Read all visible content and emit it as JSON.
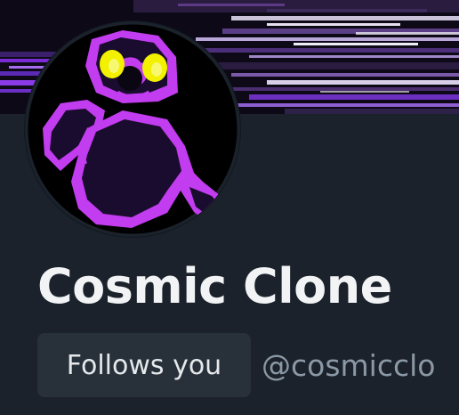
{
  "profile": {
    "display_name": "Cosmic Clone",
    "follows_you_badge": "Follows you",
    "handle": "@cosmicclo",
    "avatar_icon": "purple-character-avatar",
    "banner_icon": "glitch-banner"
  },
  "colors": {
    "background": "#1b222b",
    "banner_purple": "#7a2bd6",
    "avatar_magenta": "#c23cf0",
    "avatar_eyes": "#f3f000",
    "name_text": "#f1f3f5",
    "handle_text": "#8b98a5",
    "badge_bg": "#283039"
  }
}
